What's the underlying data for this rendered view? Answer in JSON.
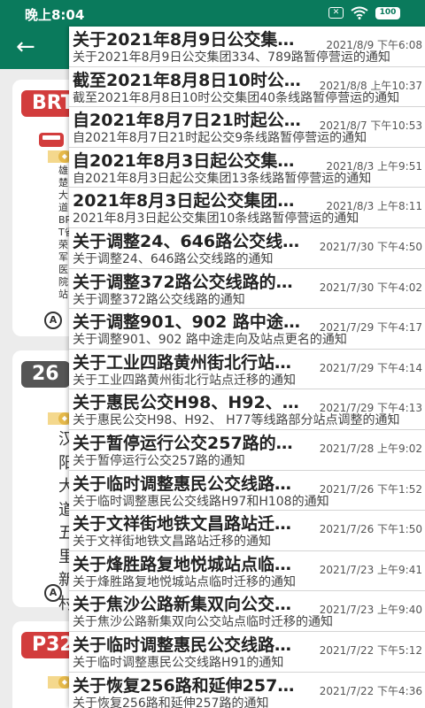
{
  "status_bar": {
    "time": "晚上8:04",
    "battery": "100"
  },
  "background": {
    "cards": [
      {
        "route": "BRT",
        "route_color": "#d23c3c",
        "stop": "雄楚大道BRT省荣军医院站",
        "refresh_label": "自"
      },
      {
        "route": "26",
        "route_color": "#555555",
        "stop": "汉阳大道五里新村",
        "refresh_label": "自"
      },
      {
        "route": "P32",
        "route_color": "#d23c3c"
      }
    ]
  },
  "notices": [
    {
      "title": "关于2021年8月9日公交集团334、789路暂停营运的通知",
      "date": "2021/8/9 下午6:08",
      "summary": "关于2021年8月9日公交集团334、789路暂停营运的通知"
    },
    {
      "title": "截至2021年8月8日10时公交集团40条线路暂停营运的通知",
      "date": "2021/8/8 上午10:37",
      "summary": "截至2021年8月8日10时公交集团40条线路暂停营运的通知"
    },
    {
      "title": "自2021年8月7日21时起公交9条线路暂停营运的通知",
      "date": "2021/8/7 下午10:53",
      "summary": "自2021年8月7日21时起公交9条线路暂停营运的通知"
    },
    {
      "title": "自2021年8月3日起公交集团13条线路暂停营运的通知",
      "date": "2021/8/3 上午9:51",
      "summary": "自2021年8月3日起公交集团13条线路暂停营运的通知"
    },
    {
      "title": "2021年8月3日起公交集团10条线路暂停营运的通知",
      "date": "2021/8/3 上午8:11",
      "summary": "2021年8月3日起公交集团10条线路暂停营运的通知"
    },
    {
      "title": "关于调整24、646路公交线路的通知",
      "date": "2021/7/30 下午4:50",
      "summary": "关于调整24、646路公交线路的通知"
    },
    {
      "title": "关于调整372路公交线路的通知",
      "date": "2021/7/30 下午4:02",
      "summary": "关于调整372路公交线路的通知"
    },
    {
      "title": "关于调整901、902 路中途走向及站点更名的通知",
      "date": "2021/7/29 下午4:17",
      "summary": "关于调整901、902 路中途走向及站点更名的通知"
    },
    {
      "title": "关于工业四路黄州街北行站点迁移的通知",
      "date": "2021/7/29 下午4:14",
      "summary": "关于工业四路黄州街北行站点迁移的通知"
    },
    {
      "title": "关于惠民公交H98、H92、H77等线路部分站点调整的通知",
      "date": "2021/7/29 下午4:13",
      "summary": "关于惠民公交H98、H92、 H77等线路部分站点调整的通知"
    },
    {
      "title": "关于暂停运行公交257路的通知",
      "date": "2021/7/28 上午9:02",
      "summary": "关于暂停运行公交257路的通知"
    },
    {
      "title": "关于临时调整惠民公交线路H97和H108的通知",
      "date": "2021/7/26 下午1:52",
      "summary": "关于临时调整惠民公交线路H97和H108的通知"
    },
    {
      "title": "关于文祥街地铁文昌路站迁移的通知",
      "date": "2021/7/26 下午1:50",
      "summary": "关于文祥街地铁文昌路站迁移的通知"
    },
    {
      "title": "关于烽胜路复地悦城站点临时迁移的通知",
      "date": "2021/7/23 上午9:41",
      "summary": "关于烽胜路复地悦城站点临时迁移的通知"
    },
    {
      "title": "关于焦沙公路新集双向公交站点临时迁移的通知",
      "date": "2021/7/23 上午9:40",
      "summary": "关于焦沙公路新集双向公交站点临时迁移的通知"
    },
    {
      "title": "关于临时调整惠民公交线路H91的通知",
      "date": "2021/7/22 下午5:12",
      "summary": "关于临时调整惠民公交线路H91的通知"
    },
    {
      "title": "关于恢复256路和延伸257路的通知",
      "date": "2021/7/22 下午4:36",
      "summary": "关于恢复256路和延伸257路的通知"
    }
  ]
}
